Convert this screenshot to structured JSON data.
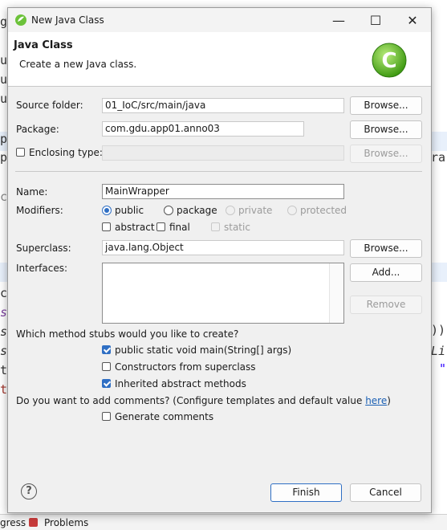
{
  "background": {
    "code_fragments": [
      "g",
      "u",
      "u",
      "u",
      "p",
      "p",
      "ra",
      "c",
      "c",
      "s",
      "s",
      "s",
      "t",
      "))",
      "Li",
      "\""
    ],
    "status_items": [
      "gress",
      "Problems"
    ]
  },
  "window": {
    "title": "New Java Class",
    "minimize_glyph": "—",
    "maximize_glyph": "☐",
    "close_glyph": "✕"
  },
  "banner": {
    "heading": "Java Class",
    "description": "Create a new Java class.",
    "logo_letter": "C",
    "logo_color": "#6cc23a"
  },
  "form": {
    "source_folder": {
      "label": "Source folder:",
      "value": "01_IoC/src/main/java",
      "button": "Browse..."
    },
    "package": {
      "label": "Package:",
      "value": "com.gdu.app01.anno03",
      "button": "Browse..."
    },
    "enclosing_type": {
      "label": "Enclosing type:",
      "value": "",
      "checked": false,
      "button": "Browse..."
    },
    "name": {
      "label": "Name:",
      "value": "MainWrapper"
    },
    "modifiers": {
      "label": "Modifiers:",
      "access": [
        "public",
        "package",
        "private",
        "protected"
      ],
      "selected_access": "public",
      "abstract": "abstract",
      "final": "final",
      "static": "static"
    },
    "superclass": {
      "label": "Superclass:",
      "value": "java.lang.Object",
      "button": "Browse..."
    },
    "interfaces": {
      "label": "Interfaces:",
      "add_button": "Add...",
      "remove_button": "Remove"
    }
  },
  "stubs": {
    "question": "Which method stubs would you like to create?",
    "options": [
      {
        "label": "public static void main(String[] args)",
        "checked": true
      },
      {
        "label": "Constructors from superclass",
        "checked": false
      },
      {
        "label": "Inherited abstract methods",
        "checked": true
      }
    ]
  },
  "comments": {
    "question_prefix": "Do you want to add comments? (Configure templates and default value ",
    "link": "here",
    "question_suffix": ")",
    "option": {
      "label": "Generate comments",
      "checked": false
    }
  },
  "footer": {
    "help_glyph": "?",
    "finish": "Finish",
    "cancel": "Cancel"
  },
  "colors": {
    "accent": "#2f6fc4",
    "dialog_bg": "#f0f0f0"
  }
}
